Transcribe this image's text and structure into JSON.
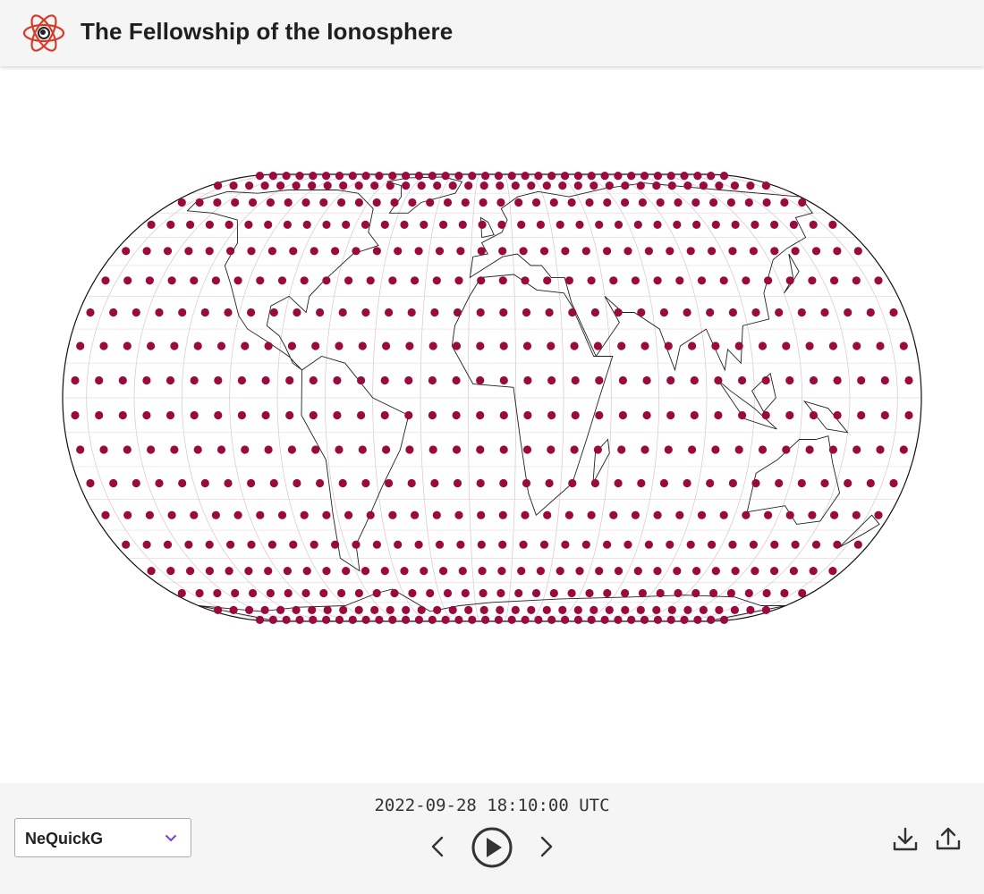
{
  "app": {
    "title": "The Fellowship of the Ionosphere",
    "logo_icon": "atom-logo-icon"
  },
  "map": {
    "projection": "Eckert IV",
    "station_color": "#9b0a3c",
    "stations_grid": {
      "lat_step_deg": 10,
      "lon_step_deg": 10
    }
  },
  "footer": {
    "timestamp": "2022-09-28 18:10:00 UTC",
    "model_select": {
      "selected": "NeQuickG"
    },
    "controls": {
      "prev_icon": "chevron-left-icon",
      "play_icon": "play-icon",
      "next_icon": "chevron-right-icon",
      "download_icon": "download-icon",
      "share_icon": "share-icon"
    }
  }
}
